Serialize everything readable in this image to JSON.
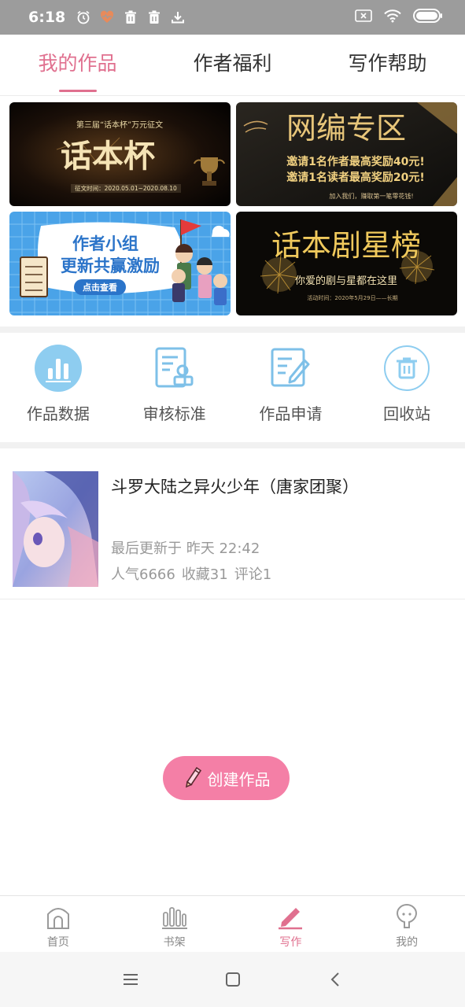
{
  "status_bar": {
    "time": "6:18",
    "left_icons": [
      "alarm-icon",
      "heart-icon",
      "trash-icon",
      "trash-icon",
      "download-icon"
    ],
    "right_icons": [
      "sim-icon",
      "wifi-icon",
      "battery-icon"
    ]
  },
  "tabs": [
    {
      "label": "我的作品",
      "active": true
    },
    {
      "label": "作者福利",
      "active": false
    },
    {
      "label": "写作帮助",
      "active": false
    }
  ],
  "banners": {
    "b1": {
      "top": "第三届“话本杯”万元征文",
      "main": "话本杯",
      "date": "征文时间：2020.05.01~2020.08.10"
    },
    "b2": {
      "main": "网编专区",
      "line1": "邀请1名作者最高奖励40元!",
      "line2": "邀请1名读者最高奖励20元!",
      "small": "加入我们，赚取第一笔零花钱!"
    },
    "b3": {
      "line1": "作者小组",
      "line2": "更新共赢激励",
      "button": "点击查看"
    },
    "b4": {
      "main": "话本剧星榜",
      "sub": "你爱的剧与星都在这里",
      "small": "活动时间：2020年5月29日——长期"
    }
  },
  "tools": [
    {
      "label": "作品数据",
      "icon": "chart-icon"
    },
    {
      "label": "审核标准",
      "icon": "review-standard-icon"
    },
    {
      "label": "作品申请",
      "icon": "edit-document-icon"
    },
    {
      "label": "回收站",
      "icon": "trash-icon"
    }
  ],
  "work": {
    "title": "斗罗大陆之异火少年（唐家团聚）",
    "updated": "最后更新于 昨天 22:42",
    "popularity": "人气6666",
    "favorites": "收藏31",
    "comments": "评论1"
  },
  "create_button": {
    "label": "创建作品"
  },
  "bottom_nav": [
    {
      "label": "首页",
      "icon": "home-icon",
      "active": false
    },
    {
      "label": "书架",
      "icon": "bookshelf-icon",
      "active": false
    },
    {
      "label": "写作",
      "icon": "pen-icon",
      "active": true
    },
    {
      "label": "我的",
      "icon": "profile-icon",
      "active": false
    }
  ],
  "colors": {
    "accent": "#e0708f",
    "button": "#f47fa6",
    "tool_blue": "#8ecdf0"
  }
}
